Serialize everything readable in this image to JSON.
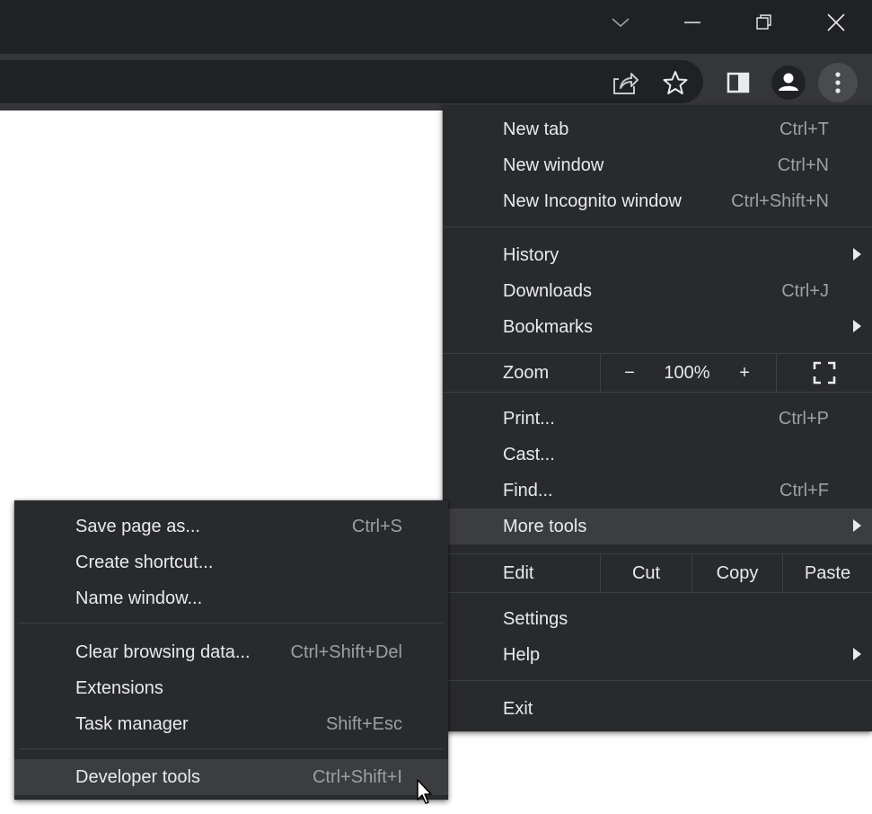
{
  "theme": {
    "menu_bg": "#292a2d",
    "highlight": "#3c3d41",
    "text": "#e8eaed",
    "shortcut_text": "#9aa0a6"
  },
  "window_controls": [
    "tab-search-icon",
    "minimize-icon",
    "restore-icon",
    "close-icon"
  ],
  "toolbar": {
    "icons": [
      "share-icon",
      "bookmark-star-icon",
      "side-panel-icon",
      "profile-icon",
      "kebab-menu-icon"
    ]
  },
  "main_menu": {
    "new_tab": {
      "label": "New tab",
      "shortcut": "Ctrl+T"
    },
    "new_window": {
      "label": "New window",
      "shortcut": "Ctrl+N"
    },
    "new_incognito": {
      "label": "New Incognito window",
      "shortcut": "Ctrl+Shift+N"
    },
    "history": {
      "label": "History"
    },
    "downloads": {
      "label": "Downloads",
      "shortcut": "Ctrl+J"
    },
    "bookmarks": {
      "label": "Bookmarks"
    },
    "zoom": {
      "label": "Zoom",
      "minus": "−",
      "value": "100%",
      "plus": "+"
    },
    "print": {
      "label": "Print...",
      "shortcut": "Ctrl+P"
    },
    "cast": {
      "label": "Cast..."
    },
    "find": {
      "label": "Find...",
      "shortcut": "Ctrl+F"
    },
    "more_tools": {
      "label": "More tools"
    },
    "edit": {
      "label": "Edit",
      "cut": "Cut",
      "copy": "Copy",
      "paste": "Paste"
    },
    "settings": {
      "label": "Settings"
    },
    "help": {
      "label": "Help"
    },
    "exit": {
      "label": "Exit"
    }
  },
  "sub_menu": {
    "save_page": {
      "label": "Save page as...",
      "shortcut": "Ctrl+S"
    },
    "create_shortcut": {
      "label": "Create shortcut..."
    },
    "name_window": {
      "label": "Name window..."
    },
    "clear_data": {
      "label": "Clear browsing data...",
      "shortcut": "Ctrl+Shift+Del"
    },
    "extensions": {
      "label": "Extensions"
    },
    "task_manager": {
      "label": "Task manager",
      "shortcut": "Shift+Esc"
    },
    "developer_tools": {
      "label": "Developer tools",
      "shortcut": "Ctrl+Shift+I"
    }
  }
}
